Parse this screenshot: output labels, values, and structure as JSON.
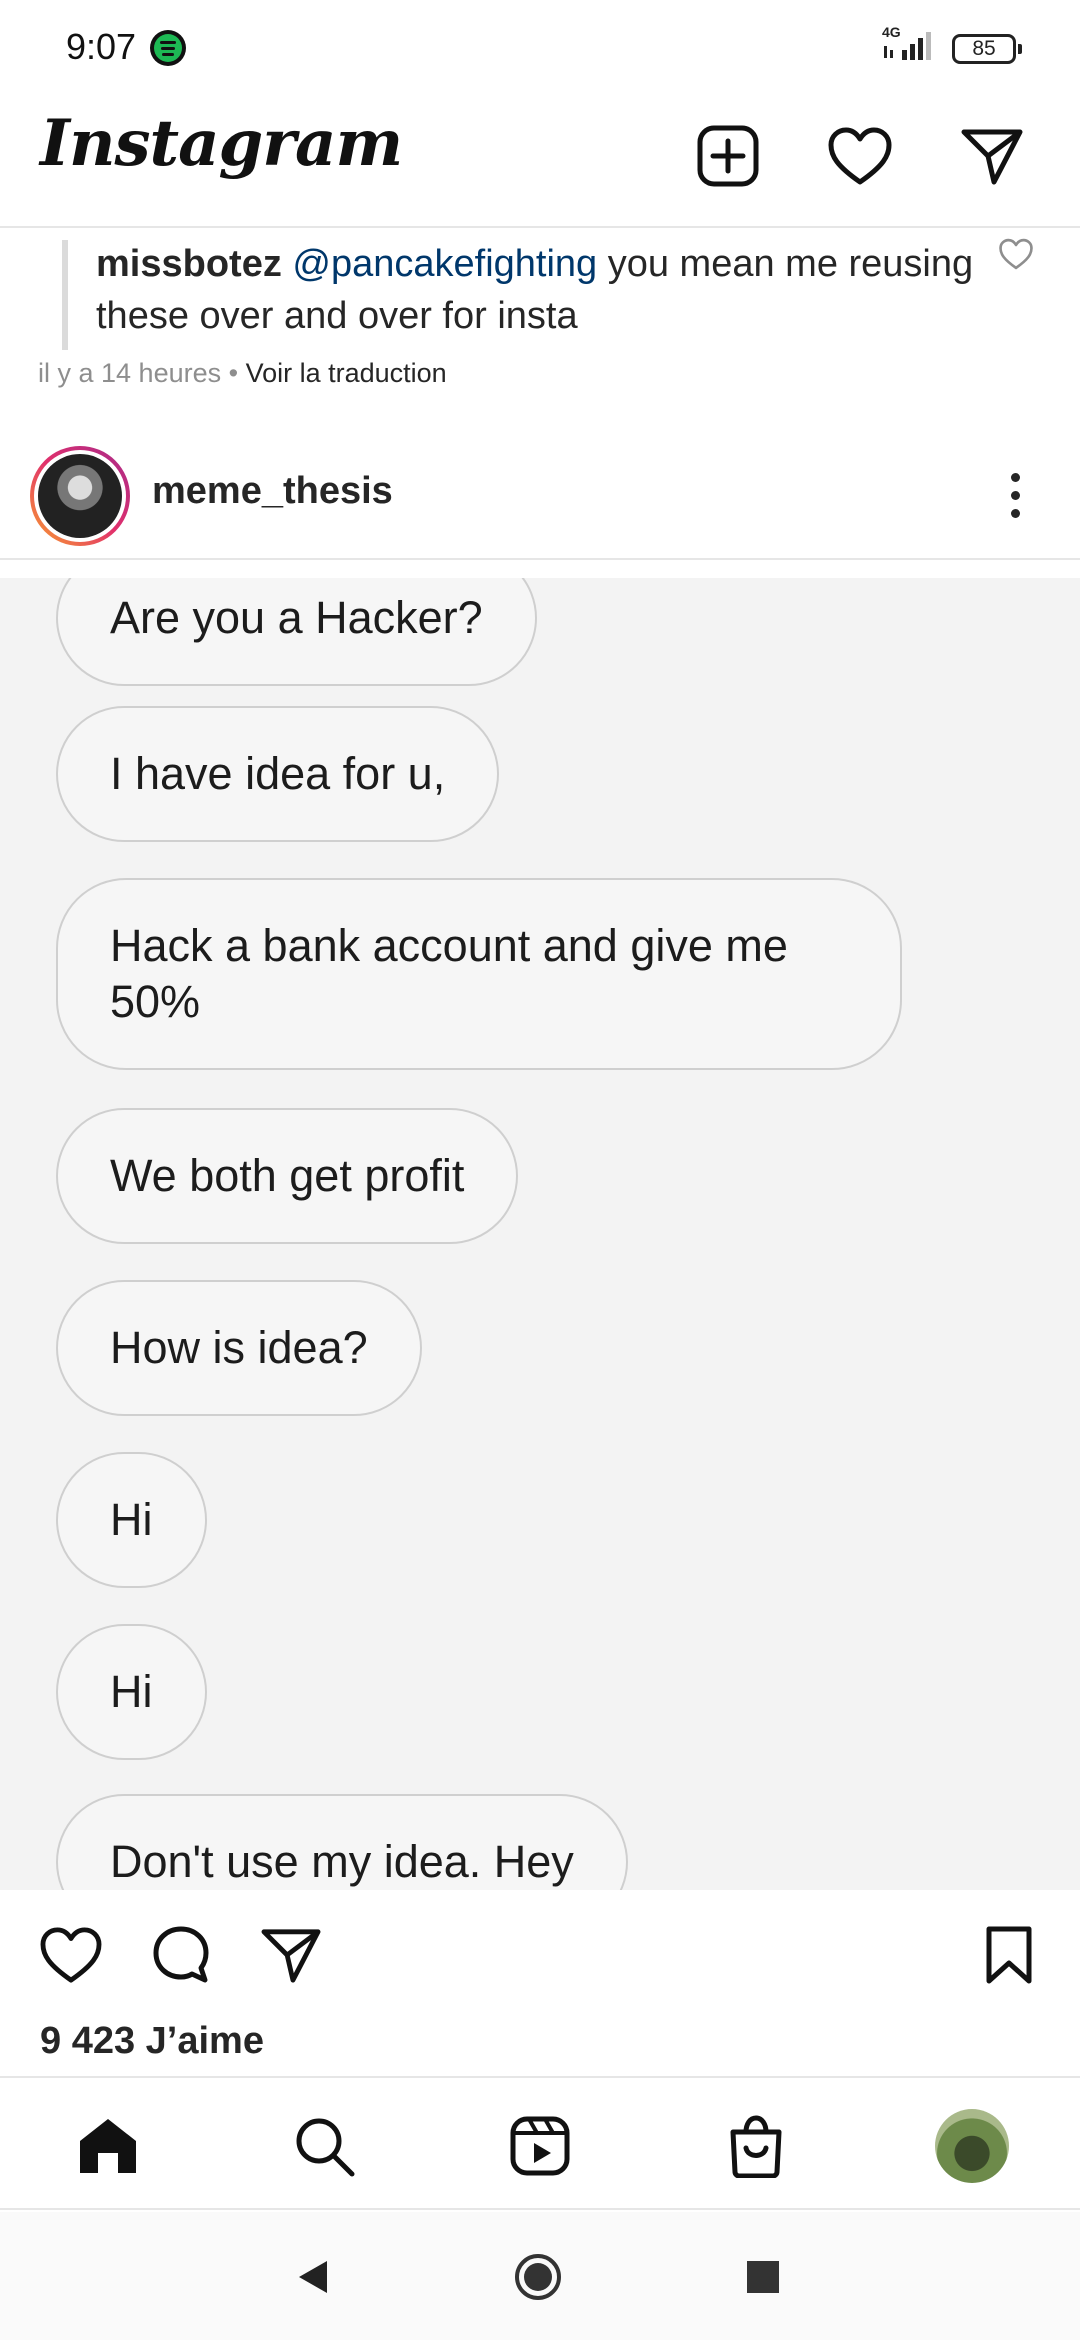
{
  "status_bar": {
    "time": "9:07",
    "network": "4G",
    "battery": "85",
    "icons": [
      "spotify-icon",
      "signal-icon",
      "battery-icon"
    ]
  },
  "header": {
    "logo": "Instagram",
    "icons": [
      "new-post-icon",
      "heart-icon",
      "direct-message-icon"
    ]
  },
  "comment": {
    "username": "missbotez",
    "mention": "@pancakefighting",
    "text": " you mean me reusing these over and over for insta",
    "time": "il y a 14 heures",
    "separator": " • ",
    "translate": "Voir la traduction"
  },
  "post": {
    "username": "meme_thesis",
    "messages": [
      "Are you a Hacker?",
      "I have idea for u,",
      "Hack a bank account and give me 50%",
      "We both get profit",
      "How is idea?",
      "Hi",
      "Hi",
      "Don't use my idea. Hey"
    ],
    "likes": "9 423 J’aime"
  },
  "bottom_nav": {
    "items": [
      "home-icon",
      "search-icon",
      "reels-icon",
      "shop-icon",
      "profile-avatar"
    ]
  },
  "system_nav": {
    "items": [
      "back-icon",
      "home-circle-icon",
      "recents-icon"
    ]
  }
}
